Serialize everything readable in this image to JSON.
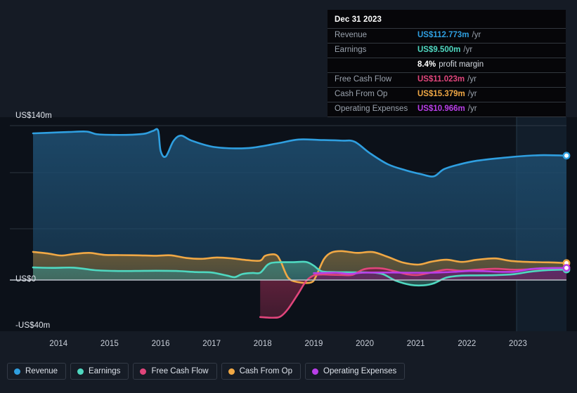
{
  "chart_data": {
    "type": "area",
    "title": "",
    "xlabel": "",
    "ylabel": "",
    "grid": true,
    "legend_position": "bottom",
    "x": [
      2013.5,
      2014,
      2015,
      2016,
      2017,
      2018,
      2019,
      2020,
      2021,
      2022,
      2023,
      2023.95
    ],
    "xtick_labels": [
      "2014",
      "2015",
      "2016",
      "2017",
      "2018",
      "2019",
      "2020",
      "2021",
      "2022",
      "2023"
    ],
    "ytick_labels": [
      "US$140m",
      "US$0",
      "-US$40m"
    ],
    "ylim": [
      -40,
      140
    ],
    "currency_prefix": "US$",
    "units": "m",
    "series": [
      {
        "name": "Revenue",
        "color": "#2f9fe0",
        "fill": "#1d4a6b",
        "end_value": 112.773,
        "points": [
          [
            2013.5,
            133.0
          ],
          [
            2013.85,
            133.6
          ],
          [
            2014.2,
            134.2
          ],
          [
            2014.55,
            134.6
          ],
          [
            2014.75,
            132.2
          ],
          [
            2015.1,
            131.6
          ],
          [
            2015.45,
            131.8
          ],
          [
            2015.7,
            132.8
          ],
          [
            2015.85,
            135.2
          ],
          [
            2015.95,
            135.6
          ],
          [
            2016.0,
            117.0
          ],
          [
            2016.1,
            112.0
          ],
          [
            2016.25,
            126.0
          ],
          [
            2016.4,
            131.0
          ],
          [
            2016.6,
            126.5
          ],
          [
            2017.0,
            121.0
          ],
          [
            2017.4,
            119.4
          ],
          [
            2017.8,
            120.0
          ],
          [
            2018.3,
            124.0
          ],
          [
            2018.7,
            127.4
          ],
          [
            2019.1,
            127.0
          ],
          [
            2019.55,
            126.4
          ],
          [
            2019.8,
            125.4
          ],
          [
            2020.1,
            115.0
          ],
          [
            2020.45,
            105.0
          ],
          [
            2020.8,
            99.5
          ],
          [
            2021.1,
            96.0
          ],
          [
            2021.35,
            94.0
          ],
          [
            2021.55,
            100.5
          ],
          [
            2021.85,
            104.8
          ],
          [
            2022.2,
            108.2
          ],
          [
            2022.7,
            110.8
          ],
          [
            2023.1,
            112.4
          ],
          [
            2023.5,
            113.2
          ],
          [
            2023.95,
            112.773
          ]
        ]
      },
      {
        "name": "Cash From Op",
        "color": "#f0a845",
        "fill": "#6a5a36",
        "end_value": 15.379,
        "points": [
          [
            2013.5,
            25.5
          ],
          [
            2013.8,
            24.0
          ],
          [
            2014.05,
            22.2
          ],
          [
            2014.3,
            23.6
          ],
          [
            2014.6,
            24.6
          ],
          [
            2014.9,
            22.8
          ],
          [
            2015.2,
            22.6
          ],
          [
            2015.55,
            22.4
          ],
          [
            2015.9,
            22.0
          ],
          [
            2016.2,
            22.4
          ],
          [
            2016.5,
            20.0
          ],
          [
            2016.8,
            19.2
          ],
          [
            2017.1,
            20.4
          ],
          [
            2017.4,
            19.6
          ],
          [
            2017.7,
            18.0
          ],
          [
            2017.95,
            17.6
          ],
          [
            2018.05,
            22.0
          ],
          [
            2018.25,
            23.0
          ],
          [
            2018.35,
            17.0
          ],
          [
            2018.5,
            2.0
          ],
          [
            2018.7,
            -2.0
          ],
          [
            2018.95,
            -2.2
          ],
          [
            2019.05,
            4.0
          ],
          [
            2019.2,
            19.0
          ],
          [
            2019.35,
            25.0
          ],
          [
            2019.55,
            26.2
          ],
          [
            2019.85,
            24.6
          ],
          [
            2020.15,
            25.4
          ],
          [
            2020.45,
            21.0
          ],
          [
            2020.75,
            15.8
          ],
          [
            2021.05,
            14.0
          ],
          [
            2021.3,
            16.6
          ],
          [
            2021.6,
            18.4
          ],
          [
            2021.9,
            16.4
          ],
          [
            2022.2,
            18.4
          ],
          [
            2022.55,
            19.6
          ],
          [
            2022.85,
            17.4
          ],
          [
            2023.2,
            16.4
          ],
          [
            2023.6,
            16.0
          ],
          [
            2023.95,
            15.379
          ]
        ]
      },
      {
        "name": "Earnings",
        "color": "#4fd8c0",
        "fill": "#3d7a72",
        "end_value": 9.5,
        "points": [
          [
            2013.5,
            11.4
          ],
          [
            2013.9,
            11.0
          ],
          [
            2014.3,
            11.2
          ],
          [
            2014.7,
            9.0
          ],
          [
            2015.1,
            8.2
          ],
          [
            2015.5,
            8.2
          ],
          [
            2015.9,
            8.4
          ],
          [
            2016.3,
            8.2
          ],
          [
            2016.7,
            7.2
          ],
          [
            2017.0,
            6.8
          ],
          [
            2017.3,
            4.0
          ],
          [
            2017.45,
            2.6
          ],
          [
            2017.6,
            5.4
          ],
          [
            2017.8,
            6.4
          ],
          [
            2017.95,
            6.6
          ],
          [
            2018.1,
            14.0
          ],
          [
            2018.25,
            16.0
          ],
          [
            2018.6,
            16.2
          ],
          [
            2018.85,
            16.4
          ],
          [
            2019.0,
            13.0
          ],
          [
            2019.15,
            8.0
          ],
          [
            2019.4,
            7.2
          ],
          [
            2019.75,
            7.0
          ],
          [
            2020.1,
            6.8
          ],
          [
            2020.35,
            5.4
          ],
          [
            2020.6,
            -0.5
          ],
          [
            2020.9,
            -4.4
          ],
          [
            2021.15,
            -4.8
          ],
          [
            2021.35,
            -3.0
          ],
          [
            2021.6,
            2.2
          ],
          [
            2021.9,
            4.0
          ],
          [
            2022.2,
            4.2
          ],
          [
            2022.55,
            4.4
          ],
          [
            2022.9,
            5.2
          ],
          [
            2023.25,
            7.6
          ],
          [
            2023.6,
            9.0
          ],
          [
            2023.95,
            9.5
          ]
        ]
      },
      {
        "name": "Free Cash Flow",
        "color": "#e0457b",
        "fill": "#6a2340",
        "end_value": 11.023,
        "points": [
          [
            2017.95,
            -33.6
          ],
          [
            2018.2,
            -34.2
          ],
          [
            2018.35,
            -33.0
          ],
          [
            2018.5,
            -26.0
          ],
          [
            2018.7,
            -12.0
          ],
          [
            2018.85,
            -1.0
          ],
          [
            2019.0,
            4.2
          ],
          [
            2019.15,
            5.0
          ],
          [
            2019.3,
            4.8
          ],
          [
            2019.55,
            4.6
          ],
          [
            2019.75,
            4.6
          ],
          [
            2019.95,
            9.2
          ],
          [
            2020.1,
            10.6
          ],
          [
            2020.35,
            10.4
          ],
          [
            2020.6,
            7.8
          ],
          [
            2020.85,
            5.0
          ],
          [
            2021.05,
            4.6
          ],
          [
            2021.3,
            6.8
          ],
          [
            2021.6,
            9.4
          ],
          [
            2021.9,
            8.4
          ],
          [
            2022.2,
            9.4
          ],
          [
            2022.55,
            10.2
          ],
          [
            2022.9,
            9.4
          ],
          [
            2023.25,
            9.8
          ],
          [
            2023.6,
            10.6
          ],
          [
            2023.95,
            11.023
          ]
        ]
      },
      {
        "name": "Operating Expenses",
        "color": "#b93fe8",
        "fill": "#5c2b6e",
        "end_value": 10.966,
        "points": [
          [
            2019.0,
            6.2
          ],
          [
            2019.2,
            6.4
          ],
          [
            2019.45,
            6.6
          ],
          [
            2019.7,
            5.6
          ],
          [
            2019.95,
            6.6
          ],
          [
            2020.25,
            6.8
          ],
          [
            2020.55,
            6.8
          ],
          [
            2020.85,
            6.6
          ],
          [
            2021.15,
            6.6
          ],
          [
            2021.45,
            6.8
          ],
          [
            2021.75,
            7.4
          ],
          [
            2022.05,
            8.2
          ],
          [
            2022.35,
            8.0
          ],
          [
            2022.65,
            7.4
          ],
          [
            2022.95,
            7.6
          ],
          [
            2023.25,
            10.0
          ],
          [
            2023.55,
            10.8
          ],
          [
            2023.95,
            10.966
          ]
        ]
      }
    ]
  },
  "y_axis": {
    "top_label": "US$140m",
    "zero_label": "US$0",
    "bottom_label": "-US$40m"
  },
  "x_axis": {
    "ticks": [
      "2014",
      "2015",
      "2016",
      "2017",
      "2018",
      "2019",
      "2020",
      "2021",
      "2022",
      "2023"
    ]
  },
  "tooltip": {
    "date": "Dec 31 2023",
    "rows": [
      {
        "key": "Revenue",
        "value": "US$112.773m",
        "unit": "/yr",
        "color": "#2f9fe0"
      },
      {
        "key": "Earnings",
        "value": "US$9.500m",
        "unit": "/yr",
        "color": "#4fd8c0"
      },
      {
        "key": "",
        "value": "8.4%",
        "sub": "profit margin",
        "color": "#ffffff"
      },
      {
        "key": "Free Cash Flow",
        "value": "US$11.023m",
        "unit": "/yr",
        "color": "#e0457b"
      },
      {
        "key": "Cash From Op",
        "value": "US$15.379m",
        "unit": "/yr",
        "color": "#f0a845"
      },
      {
        "key": "Operating Expenses",
        "value": "US$10.966m",
        "unit": "/yr",
        "color": "#b93fe8"
      }
    ]
  },
  "legend": {
    "items": [
      {
        "label": "Revenue",
        "color": "#2f9fe0"
      },
      {
        "label": "Earnings",
        "color": "#4fd8c0"
      },
      {
        "label": "Free Cash Flow",
        "color": "#e0457b"
      },
      {
        "label": "Cash From Op",
        "color": "#f0a845"
      },
      {
        "label": "Operating Expenses",
        "color": "#b93fe8"
      }
    ]
  }
}
